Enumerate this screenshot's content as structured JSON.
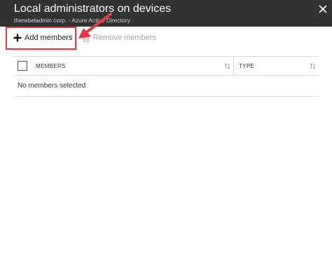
{
  "blade": {
    "title": "Local administrators on devices",
    "subtitle": "therebeladmin corp. - Azure Active Directory",
    "close_icon": "close-icon"
  },
  "toolbar": {
    "add_label": "Add members",
    "add_icon": "plus-icon",
    "remove_label": "Remove members",
    "remove_icon": "trash-icon"
  },
  "grid": {
    "columns": [
      {
        "label": "MEMBERS",
        "sort_icon": "sort-arrows-icon"
      },
      {
        "label": "TYPE",
        "sort_icon": "sort-arrows-icon"
      }
    ],
    "empty_message": "No members selected"
  },
  "annotation": {
    "color": "#e53942"
  }
}
